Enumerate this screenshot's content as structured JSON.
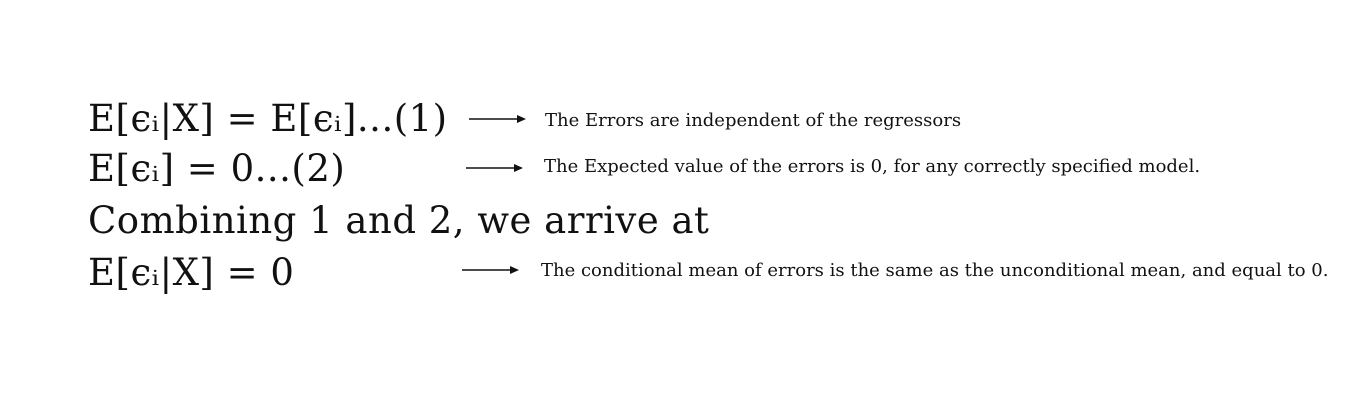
{
  "equations": [
    {
      "text": "E[ϵᵢ|X] = E[ϵᵢ]...(1)"
    },
    {
      "text": "E[ϵᵢ] = 0...(2)"
    },
    {
      "text": "Combining 1 and 2, we arrive at"
    },
    {
      "text": "E[ϵᵢ|X] = 0"
    }
  ],
  "annotations": [
    {
      "text": "The Errors are independent of the regressors"
    },
    {
      "text": "The Expected value of the errors is 0, for any correctly specified model."
    },
    {
      "text": "The conditional mean of errors is the same as the unconditional mean, and equal to 0."
    }
  ],
  "colors": {
    "text": "#111111",
    "background": "#ffffff"
  }
}
